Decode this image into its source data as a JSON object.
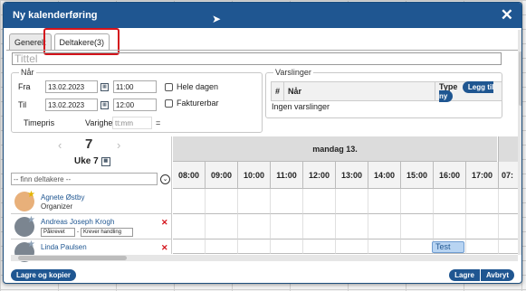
{
  "dialog": {
    "title": "Ny kalenderføring",
    "close": "✕",
    "tabs": [
      "Generelt",
      "Deltakere(3)"
    ],
    "title_placeholder": "Tittel"
  },
  "naar": {
    "legend": "Når",
    "fra_label": "Fra",
    "fra_date": "13.02.2023",
    "fra_time": "11:00",
    "til_label": "Til",
    "til_date": "13.02.2023",
    "til_time": "12:00",
    "hele_dagen": "Hele dagen",
    "fakturerbar": "Fakturerbar",
    "timepris_label": "Timepris",
    "varighet_label": "Varighet",
    "varighet_placeholder": "tt:mm",
    "equals": "="
  },
  "varslinger": {
    "legend": "Varslinger",
    "col_hash": "#",
    "col_naar": "Når",
    "col_type": "Type",
    "add_button": "Legg til ny",
    "empty": "Ingen varslinger"
  },
  "participants": {
    "day_number": "7",
    "week_label": "Uke 7",
    "find_placeholder": "-- finn deltakere --",
    "people": [
      {
        "name": "Agnete Østby",
        "role": "Organizer"
      },
      {
        "name": "Andreas Joseph Krogh",
        "req": "Påkrevet",
        "action": "Krever handling"
      },
      {
        "name": "Linda Paulsen"
      }
    ]
  },
  "calendar": {
    "day_header": "mandag 13.",
    "hours": [
      "08:00",
      "09:00",
      "10:00",
      "11:00",
      "12:00",
      "13:00",
      "14:00",
      "15:00",
      "16:00",
      "17:00",
      "07:"
    ],
    "event_label": "Test"
  },
  "footer": {
    "save_copy": "Lagre og kopier",
    "save": "Lagre",
    "cancel": "Avbryt"
  }
}
